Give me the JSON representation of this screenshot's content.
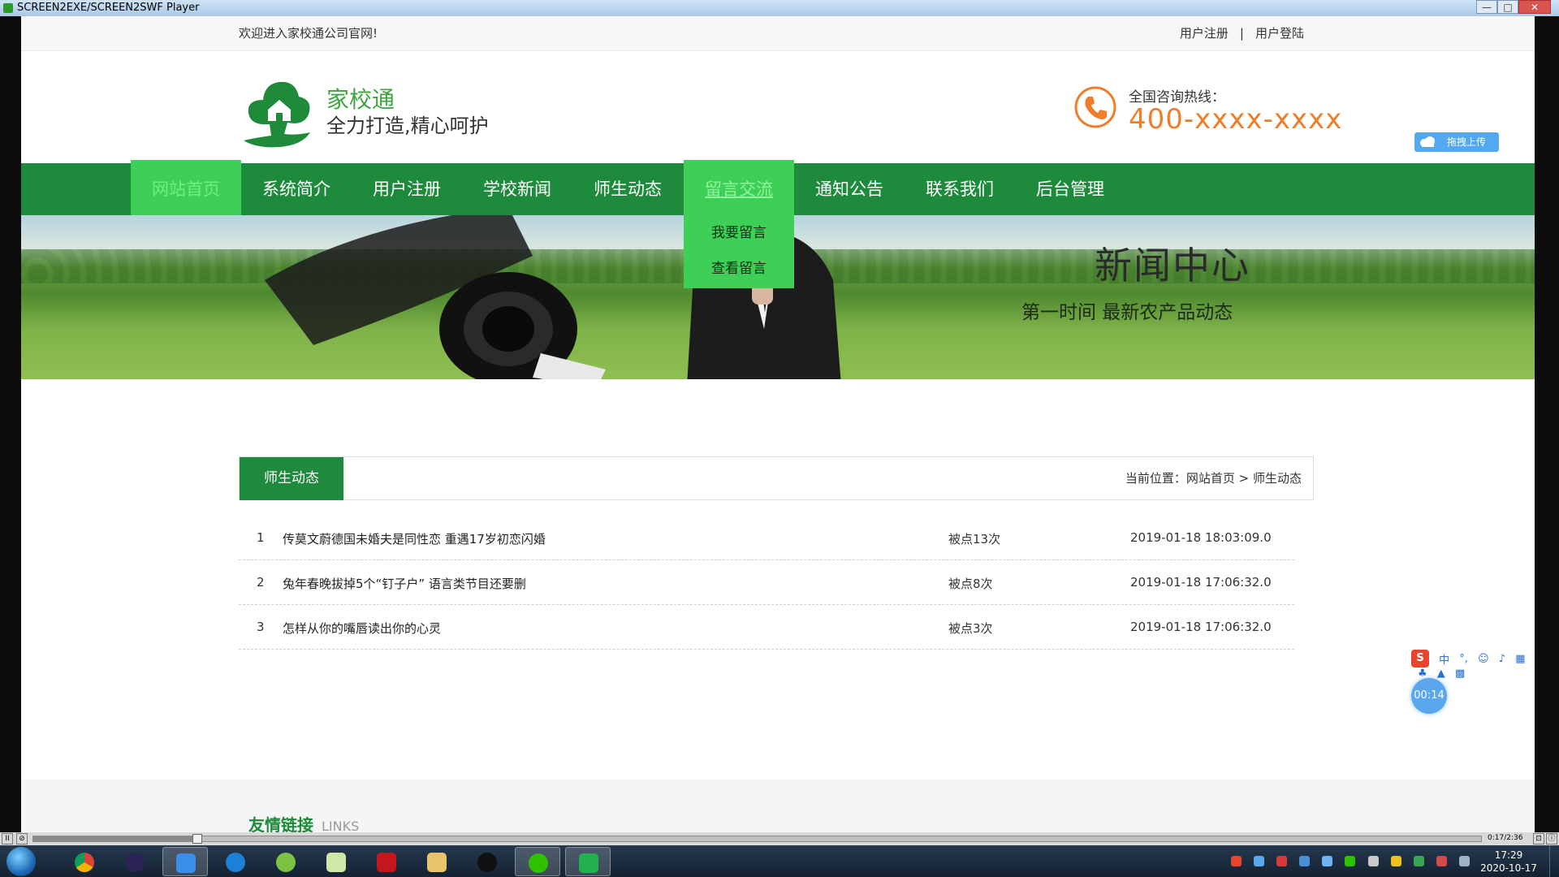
{
  "window": {
    "title": "SCREEN2EXE/SCREEN2SWF Player",
    "minimize": "—",
    "maximize": "□",
    "close": "✕"
  },
  "site": {
    "welcome": "欢迎进入家校通公司官网!",
    "register_link": "用户注册",
    "login_link": "用户登陆",
    "separator": "|",
    "logo_title": "家校通",
    "logo_slogan": "全力打造,精心呵护",
    "hotline_label": "全国咨询热线：",
    "hotline_number": "400-xxxx-xxxx",
    "upload_label": "拖拽上传"
  },
  "nav": {
    "items": [
      {
        "label": "网站首页"
      },
      {
        "label": "系统简介"
      },
      {
        "label": "用户注册"
      },
      {
        "label": "学校新闻"
      },
      {
        "label": "师生动态"
      },
      {
        "label": "留言交流"
      },
      {
        "label": "通知公告"
      },
      {
        "label": "联系我们"
      },
      {
        "label": "后台管理"
      }
    ],
    "dropdown": [
      "我要留言",
      "查看留言"
    ]
  },
  "banner": {
    "title": "新闻中心",
    "subtitle": "第一时间  最新农产品动态"
  },
  "section": {
    "tab": "师生动态",
    "breadcrumb": "当前位置：网站首页 > 师生动态"
  },
  "news": [
    {
      "index": "1",
      "title": "传莫文蔚德国未婚夫是同性恋 重遇17岁初恋闪婚",
      "hits": "被点13次",
      "date": "2019-01-18 18:03:09.0"
    },
    {
      "index": "2",
      "title": "兔年春晚拔掉5个“钉子户” 语言类节目还要删",
      "hits": "被点8次",
      "date": "2019-01-18 17:06:32.0"
    },
    {
      "index": "3",
      "title": "怎样从你的嘴唇读出你的心灵",
      "hits": "被点3次",
      "date": "2019-01-18 17:06:32.0"
    }
  ],
  "footer": {
    "links_title": "友情链接",
    "links_en": "LINKS"
  },
  "overlay": {
    "ime_logo": "S",
    "ime_mode": "中",
    "ime_punct": "°,",
    "timer": "00:14"
  },
  "player": {
    "play_pause": "II",
    "zoom": "⊘",
    "progress": 0.11,
    "time": "0:17/2:36"
  },
  "taskbar": {
    "apps": [
      "chrome-icon",
      "eclipse-icon",
      "baidu-netdisk-icon",
      "browser-icon",
      "android-icon",
      "notepad-icon",
      "flash-icon",
      "file-explorer-icon",
      "qq-icon",
      "wechat-icon",
      "recorder-icon"
    ],
    "clock_time": "17:29",
    "clock_date": "2020-10-17"
  },
  "colors": {
    "brand_green": "#1e8a3c",
    "nav_highlight": "#3ecf57",
    "hotline_orange": "#f07d2a"
  }
}
